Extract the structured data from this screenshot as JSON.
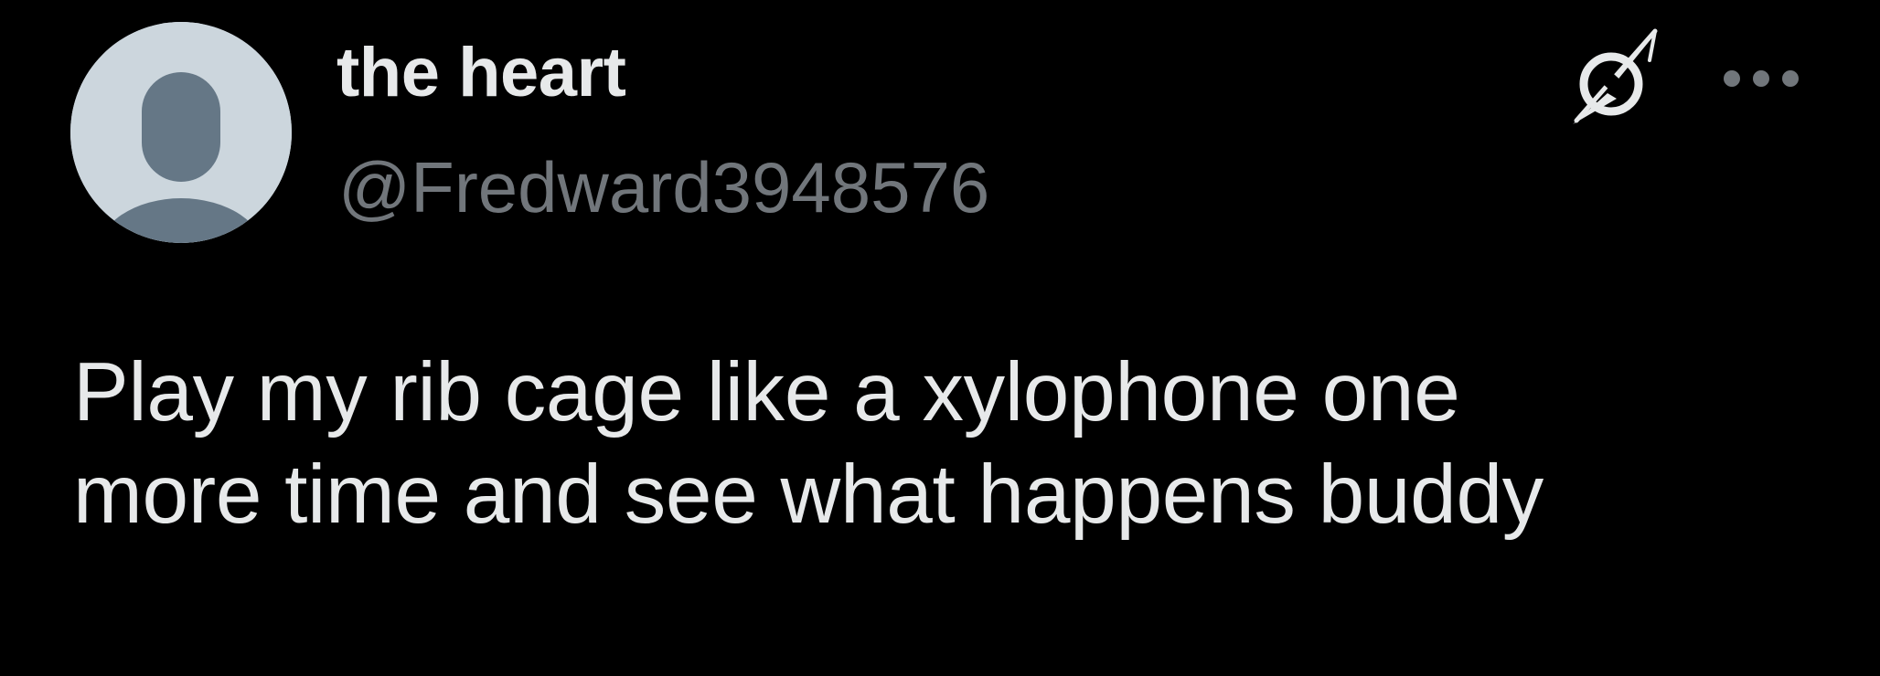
{
  "author": {
    "display_name": "the heart",
    "handle": "@Fredward3948576",
    "avatar": "default-avatar-silhouette"
  },
  "tweet": {
    "text_lines": [
      "Play my rib cage like a xylophone one",
      "more time and see what happens buddy"
    ]
  },
  "actions": {
    "grok_icon": "grok-icon",
    "more_icon": "more-options-icon"
  },
  "colors": {
    "background": "#000000",
    "primary_text": "#e7e9ea",
    "secondary_text": "#71767b",
    "avatar_bg": "#ccd6dd",
    "avatar_silhouette": "#657786"
  }
}
